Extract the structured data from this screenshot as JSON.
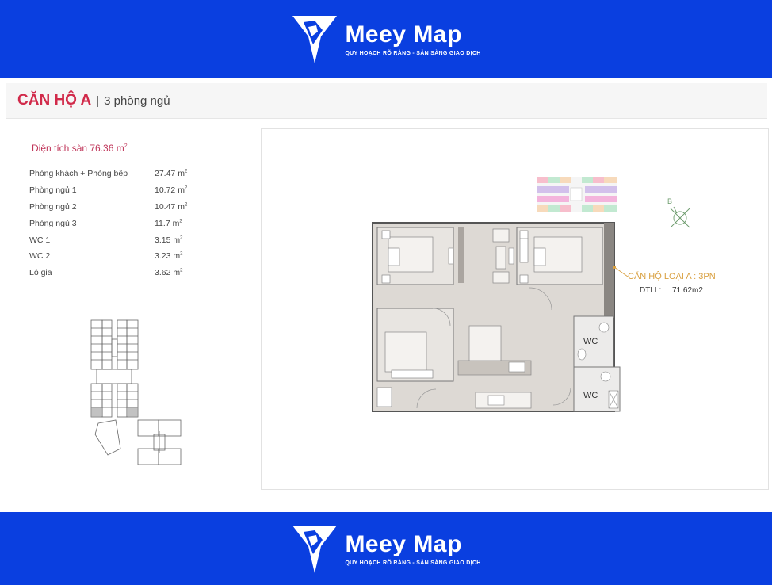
{
  "brand": {
    "name": "Meey Map",
    "tagline": "QUY HOẠCH RÕ RÀNG - SẴN SÀNG GIAO DỊCH",
    "color": "#0a3fe0",
    "logo_icon": "meey-logo-icon"
  },
  "header": {
    "title": "CĂN HỘ A",
    "separator": "|",
    "subtitle": "3 phòng ngủ"
  },
  "area": {
    "label": "Diện tích sàn 76.36 m",
    "unit_sup": "2",
    "rooms": [
      {
        "name": "Phòng khách + Phòng bếp",
        "value": "27.47 m",
        "sup": "2"
      },
      {
        "name": "Phòng ngủ 1",
        "value": "10.72 m",
        "sup": "2"
      },
      {
        "name": "Phòng ngủ 2",
        "value": "10.47 m",
        "sup": "2"
      },
      {
        "name": "Phòng ngủ 3",
        "value": "11.7 m",
        "sup": "2"
      },
      {
        "name": "WC 1",
        "value": "3.15 m",
        "sup": "2"
      },
      {
        "name": "WC 2",
        "value": "3.23 m",
        "sup": "2"
      },
      {
        "name": "Lô gia",
        "value": "3.62 m",
        "sup": "2"
      }
    ]
  },
  "floorplan": {
    "apartment_label": "CĂN HỘ LOẠI A : 3PN",
    "dtll_label": "DTLL:",
    "dtll_value": "71.62m2",
    "wc_label_1": "WC",
    "wc_label_2": "WC",
    "compass_label": "B"
  }
}
